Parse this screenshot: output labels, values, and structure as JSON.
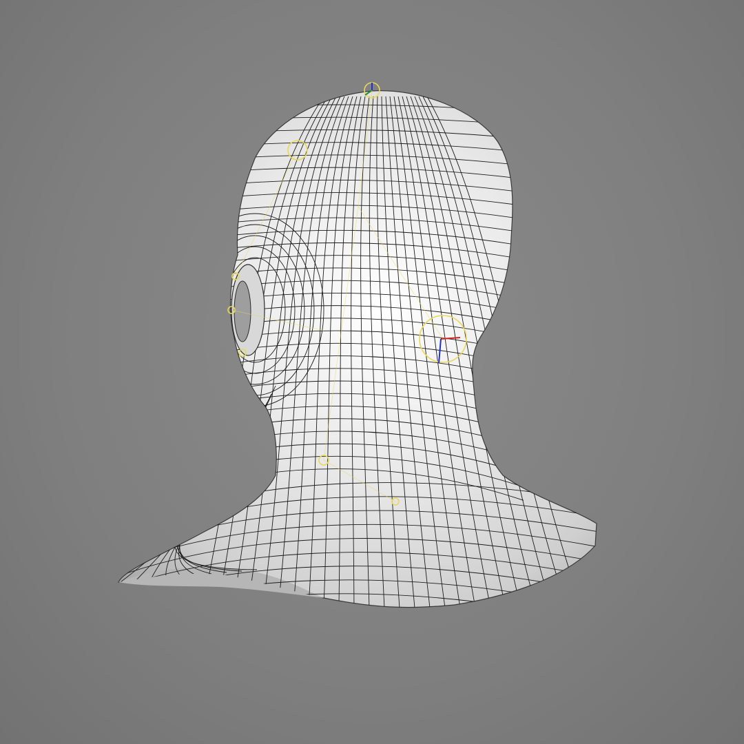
{
  "viewport": {
    "background_color": "#7f7f7f",
    "shading": "smooth-shaded-with-wireframe"
  },
  "model": {
    "subject": "head-and-shoulders-bust",
    "view": "rear-three-quarter",
    "surface_color": "#e6e6e6",
    "wire_color": "#1a1a1a"
  },
  "rig": {
    "controller_color": "#e8d85a",
    "axis_colors": {
      "x": "#d02020",
      "y": "#2a8a2a",
      "z": "#2030c8"
    },
    "visible_manipulators": [
      "head-top-joint",
      "neck-joint",
      "ear-joint"
    ]
  }
}
